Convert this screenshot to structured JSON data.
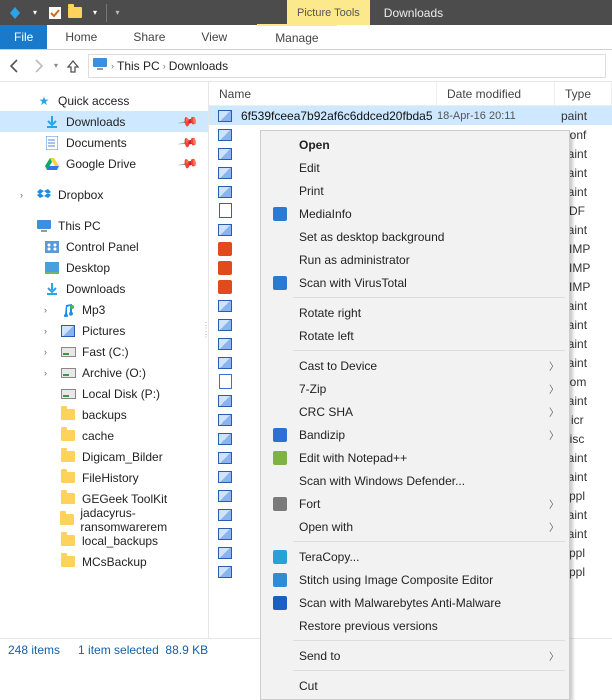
{
  "titlebar": {
    "context_tab": "Picture Tools",
    "location": "Downloads"
  },
  "ribbon": {
    "file": "File",
    "tabs": [
      "Home",
      "Share",
      "View"
    ],
    "context_tab": "Manage"
  },
  "nav": {
    "addr1": "This PC",
    "addr2": "Downloads"
  },
  "sidebar": {
    "quick_access": "Quick access",
    "qa_items": [
      "Downloads",
      "Documents",
      "Google Drive"
    ],
    "dropbox": "Dropbox",
    "this_pc": "This PC",
    "pc_items": [
      "Control Panel",
      "Desktop",
      "Downloads",
      "Mp3",
      "Pictures",
      "Fast (C:)",
      "Archive (O:)",
      "Local Disk (P:)"
    ],
    "p_children": [
      "backups",
      "cache",
      "Digicam_Bilder",
      "FileHistory",
      "GEGeek ToolKit",
      "jadacyrus-ransomwarerem",
      "local_backups",
      "MCsBackup"
    ]
  },
  "columns": {
    "name": "Name",
    "date": "Date modified",
    "type": "Type"
  },
  "selected_row": {
    "name": "6f539fceea7b92af6c6ddced20fbda5",
    "date": "18-Apr-16 20:11",
    "type": "paint"
  },
  "row_types": [
    "Conf",
    "paint",
    "paint",
    "paint",
    "PDF",
    "paint",
    "AIMP",
    "AIMP",
    "AIMP",
    "paint",
    "paint",
    "paint",
    "paint",
    "Com",
    "paint",
    "Micr",
    "Disc",
    "paint",
    "paint",
    "Appl",
    "paint",
    "paint",
    "Appl",
    "Appl"
  ],
  "row_kinds": [
    "img",
    "img",
    "img",
    "img",
    "pdf",
    "img",
    "aud",
    "aud",
    "aud",
    "img",
    "img",
    "img",
    "img",
    "zip",
    "img",
    "img",
    "img",
    "img",
    "img",
    "img",
    "img",
    "img",
    "img",
    "img"
  ],
  "context_menu": [
    {
      "label": "Open",
      "bold": true
    },
    {
      "label": "Edit"
    },
    {
      "label": "Print"
    },
    {
      "label": "MediaInfo",
      "icon": "media"
    },
    {
      "label": "Set as desktop background"
    },
    {
      "label": "Run as administrator"
    },
    {
      "label": "Scan with VirusTotal",
      "icon": "vt"
    },
    {
      "sep": true
    },
    {
      "label": "Rotate right"
    },
    {
      "label": "Rotate left"
    },
    {
      "sep": true
    },
    {
      "label": "Cast to Device",
      "sub": true
    },
    {
      "label": "7-Zip",
      "sub": true
    },
    {
      "label": "CRC SHA",
      "sub": true
    },
    {
      "label": "Bandizip",
      "sub": true,
      "icon": "bz"
    },
    {
      "label": "Edit with Notepad++",
      "icon": "npp"
    },
    {
      "label": "Scan with Windows Defender..."
    },
    {
      "label": "Fort",
      "sub": true,
      "icon": "fort"
    },
    {
      "label": "Open with",
      "sub": true
    },
    {
      "sep": true
    },
    {
      "label": "TeraCopy...",
      "icon": "tc"
    },
    {
      "label": "Stitch using Image Composite Editor",
      "icon": "ice"
    },
    {
      "label": "Scan with Malwarebytes Anti-Malware",
      "icon": "mb"
    },
    {
      "label": "Restore previous versions"
    },
    {
      "sep": true
    },
    {
      "label": "Send to",
      "sub": true
    },
    {
      "sep": true
    },
    {
      "label": "Cut"
    }
  ],
  "status": {
    "items": "248 items",
    "selected": "1 item selected",
    "size": "88.9 KB"
  }
}
